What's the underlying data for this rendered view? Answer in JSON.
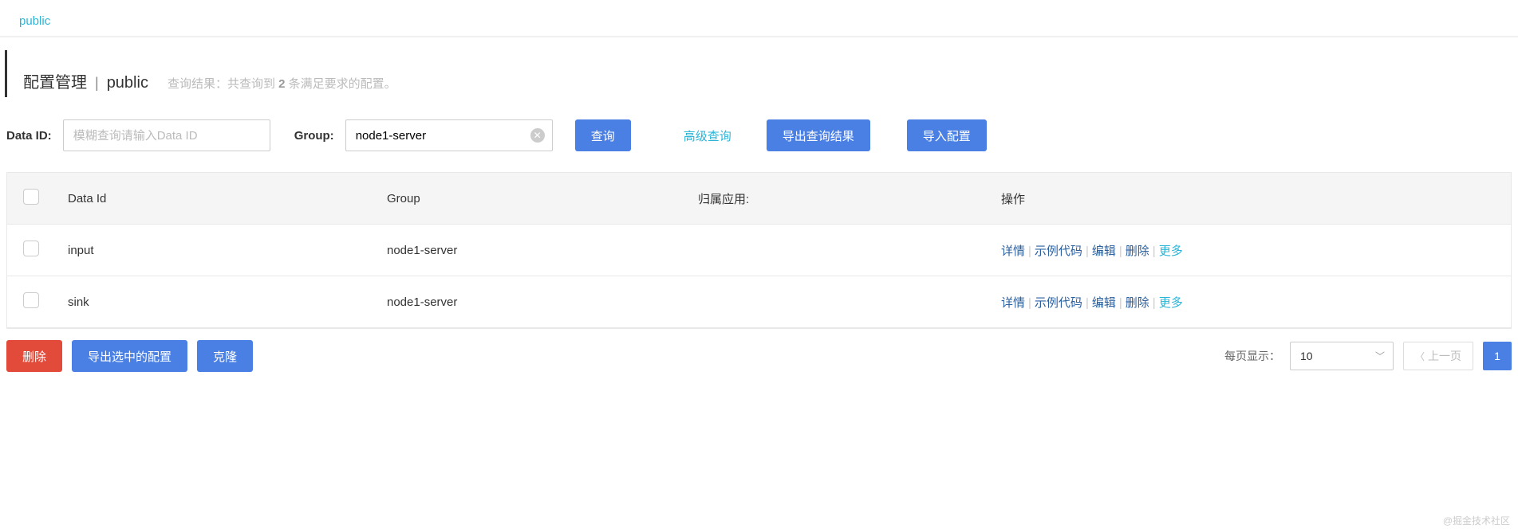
{
  "tabs": {
    "public": "public"
  },
  "header": {
    "title": "配置管理",
    "subtitle": "public",
    "result_prefix": "查询结果：共查询到 ",
    "result_count": "2",
    "result_suffix": " 条满足要求的配置。"
  },
  "filters": {
    "data_id_label": "Data ID:",
    "data_id_placeholder": "模糊查询请输入Data ID",
    "data_id_value": "",
    "group_label": "Group:",
    "group_value": "node1-server",
    "search_btn": "查询",
    "advanced_btn": "高级查询",
    "export_result_btn": "导出查询结果",
    "import_btn": "导入配置"
  },
  "table": {
    "columns": {
      "data_id": "Data Id",
      "group": "Group",
      "app": "归属应用:",
      "ops": "操作"
    },
    "rows": [
      {
        "data_id": "input",
        "group": "node1-server",
        "app": ""
      },
      {
        "data_id": "sink",
        "group": "node1-server",
        "app": ""
      }
    ],
    "actions": {
      "detail": "详情",
      "sample": "示例代码",
      "edit": "编辑",
      "delete": "删除",
      "more": "更多"
    }
  },
  "bottom": {
    "delete_btn": "删除",
    "export_selected_btn": "导出选中的配置",
    "clone_btn": "克隆",
    "page_size_label": "每页显示：",
    "page_size_value": "10",
    "prev_btn": "上一页",
    "current_page": "1"
  },
  "watermark": "@掘金技术社区"
}
